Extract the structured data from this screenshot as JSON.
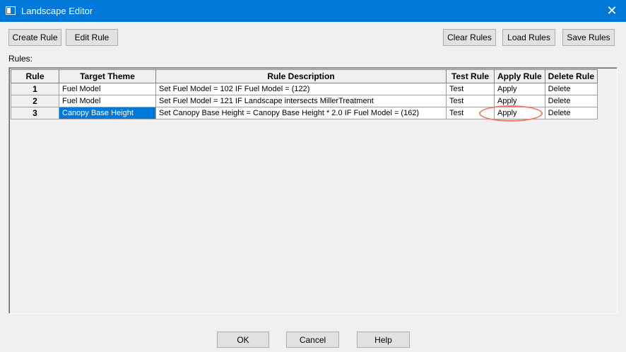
{
  "window": {
    "title": "Landscape Editor"
  },
  "toolbar": {
    "create_rule": "Create Rule",
    "edit_rule": "Edit Rule",
    "clear_rules": "Clear Rules",
    "load_rules": "Load Rules",
    "save_rules": "Save Rules"
  },
  "rules_label": "Rules:",
  "table": {
    "headers": [
      "Rule",
      "Target Theme",
      "Rule Description",
      "Test Rule",
      "Apply Rule",
      "Delete Rule"
    ],
    "rows": [
      {
        "rule": "1",
        "target": "Fuel Model",
        "description": "Set Fuel Model = 102 IF Fuel Model = (122)",
        "test": "Test",
        "apply": "Apply",
        "delete": "Delete"
      },
      {
        "rule": "2",
        "target": "Fuel Model",
        "description": "Set Fuel Model = 121 IF Landscape intersects MillerTreatment",
        "test": "Test",
        "apply": "Apply",
        "delete": "Delete"
      },
      {
        "rule": "3",
        "target": "Canopy Base Height",
        "description": "Set Canopy Base Height = Canopy Base Height * 2.0 IF Fuel Model = (162)",
        "test": "Test",
        "apply": "Apply",
        "delete": "Delete"
      }
    ]
  },
  "footer": {
    "ok": "OK",
    "cancel": "Cancel",
    "help": "Help"
  },
  "colors": {
    "titlebar": "#0078d7",
    "selection": "#0078d7",
    "highlight": "#f07a6a"
  }
}
